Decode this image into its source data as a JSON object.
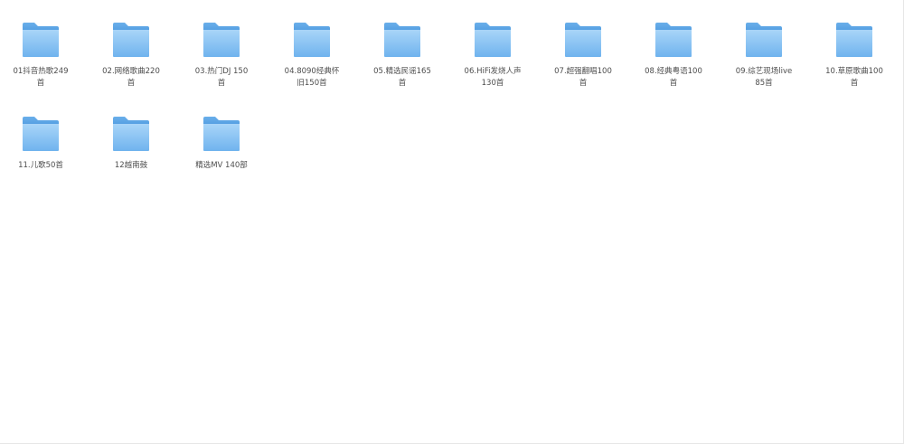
{
  "folders": [
    {
      "label": "01抖音热歌249首",
      "icon": "folder-icon"
    },
    {
      "label": "02.网络歌曲220首",
      "icon": "folder-icon"
    },
    {
      "label": "03.热门DJ 150首",
      "icon": "folder-icon"
    },
    {
      "label": "04.8090经典怀旧150首",
      "icon": "folder-icon"
    },
    {
      "label": "05.精选民谣165首",
      "icon": "folder-icon"
    },
    {
      "label": "06.HiFi发烧人声130首",
      "icon": "folder-icon"
    },
    {
      "label": "07.超强翻唱100首",
      "icon": "folder-icon"
    },
    {
      "label": "08.经典粤语100首",
      "icon": "folder-icon"
    },
    {
      "label": "09.综艺现场live85首",
      "icon": "folder-icon"
    },
    {
      "label": "10.草原歌曲100首",
      "icon": "folder-icon"
    },
    {
      "label": "11.儿歌50首",
      "icon": "folder-icon"
    },
    {
      "label": "12越南鼓",
      "icon": "folder-icon"
    },
    {
      "label": "精选MV 140部",
      "icon": "folder-icon"
    }
  ],
  "colors": {
    "folder_back": "#5ea8ea",
    "folder_front_top": "#a6d3f8",
    "folder_front_bottom": "#72b6ef",
    "label_text": "#4d4d4d"
  }
}
